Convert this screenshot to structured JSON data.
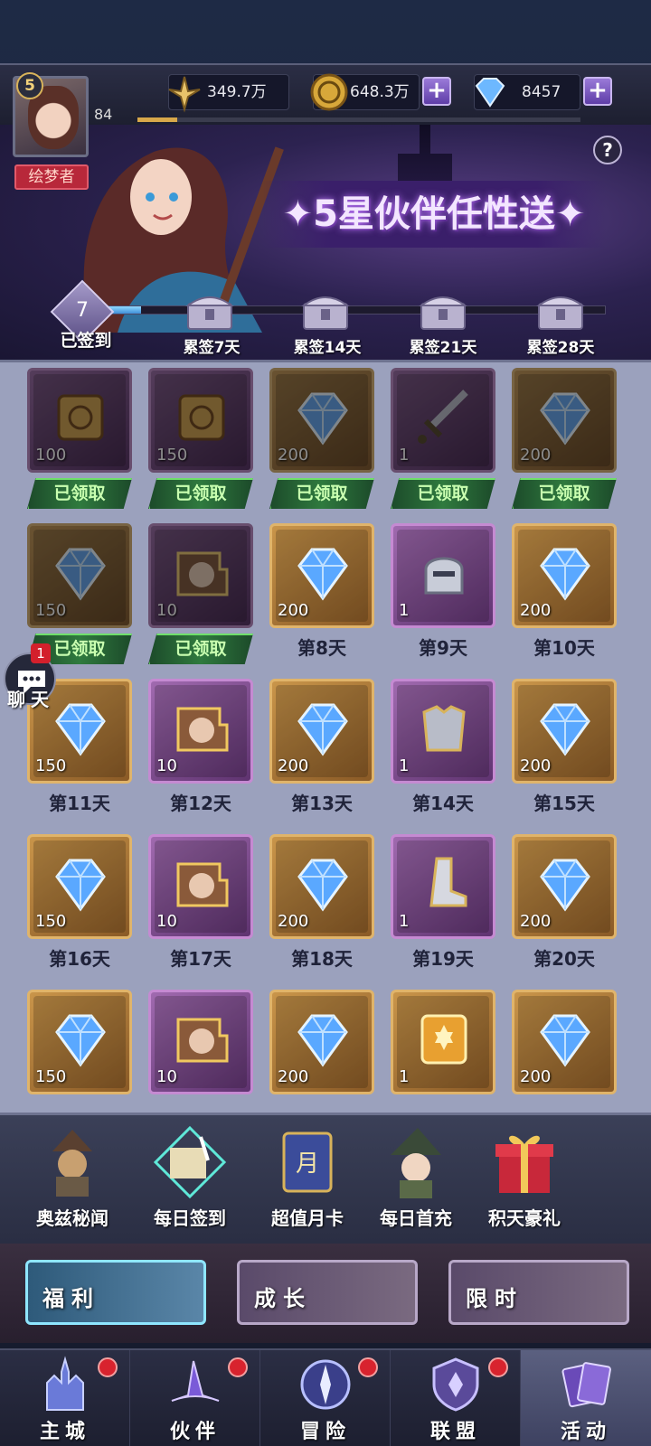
{
  "header": {
    "level": "5",
    "exp": "84",
    "nickname": "绘梦者",
    "power": "349.7万",
    "gold": "648.3万",
    "diamonds": "8457",
    "help": "?"
  },
  "banner": {
    "title": "✦5星伙伴任性送✦",
    "signed_days": "7",
    "signed_label": "已签到",
    "progress_fraction": 0.08,
    "milestones": [
      "累签7天",
      "累签14天",
      "累签21天",
      "累签28天"
    ]
  },
  "rewards": [
    {
      "item": "scroll-icon",
      "qty": "100",
      "label": "已领取",
      "claimed": true,
      "frame": "purple"
    },
    {
      "item": "scroll-icon",
      "qty": "150",
      "label": "已领取",
      "claimed": true,
      "frame": "purple"
    },
    {
      "item": "diamond-icon",
      "qty": "200",
      "label": "已领取",
      "claimed": true,
      "frame": "gold"
    },
    {
      "item": "sword-icon",
      "qty": "1",
      "label": "已领取",
      "claimed": true,
      "frame": "purple"
    },
    {
      "item": "diamond-icon",
      "qty": "200",
      "label": "已领取",
      "claimed": true,
      "frame": "gold"
    },
    {
      "item": "diamond-icon",
      "qty": "150",
      "label": "已领取",
      "claimed": true,
      "frame": "gold"
    },
    {
      "item": "hero-fragment-icon",
      "qty": "10",
      "label": "已领取",
      "claimed": true,
      "frame": "purple"
    },
    {
      "item": "diamond-icon",
      "qty": "200",
      "label": "第8天",
      "claimed": false,
      "frame": "gold"
    },
    {
      "item": "helmet-icon",
      "qty": "1",
      "label": "第9天",
      "claimed": false,
      "frame": "purple"
    },
    {
      "item": "diamond-icon",
      "qty": "200",
      "label": "第10天",
      "claimed": false,
      "frame": "gold"
    },
    {
      "item": "diamond-icon",
      "qty": "150",
      "label": "第11天",
      "claimed": false,
      "frame": "gold"
    },
    {
      "item": "hero-fragment-icon",
      "qty": "10",
      "label": "第12天",
      "claimed": false,
      "frame": "purple"
    },
    {
      "item": "diamond-icon",
      "qty": "200",
      "label": "第13天",
      "claimed": false,
      "frame": "gold"
    },
    {
      "item": "armor-icon",
      "qty": "1",
      "label": "第14天",
      "claimed": false,
      "frame": "purple"
    },
    {
      "item": "diamond-icon",
      "qty": "200",
      "label": "第15天",
      "claimed": false,
      "frame": "gold"
    },
    {
      "item": "diamond-icon",
      "qty": "150",
      "label": "第16天",
      "claimed": false,
      "frame": "gold"
    },
    {
      "item": "hero-fragment-icon",
      "qty": "10",
      "label": "第17天",
      "claimed": false,
      "frame": "purple"
    },
    {
      "item": "diamond-icon",
      "qty": "200",
      "label": "第18天",
      "claimed": false,
      "frame": "gold"
    },
    {
      "item": "boots-icon",
      "qty": "1",
      "label": "第19天",
      "claimed": false,
      "frame": "purple"
    },
    {
      "item": "diamond-icon",
      "qty": "200",
      "label": "第20天",
      "claimed": false,
      "frame": "gold"
    },
    {
      "item": "diamond-icon",
      "qty": "150",
      "label": "",
      "claimed": false,
      "frame": "gold"
    },
    {
      "item": "hero-fragment-icon",
      "qty": "10",
      "label": "",
      "claimed": false,
      "frame": "purple"
    },
    {
      "item": "diamond-icon",
      "qty": "200",
      "label": "",
      "claimed": false,
      "frame": "gold"
    },
    {
      "item": "relic-icon",
      "qty": "1",
      "label": "",
      "claimed": false,
      "frame": "gold"
    },
    {
      "item": "diamond-icon",
      "qty": "200",
      "label": "",
      "claimed": false,
      "frame": "gold"
    }
  ],
  "chat": {
    "badge": "1",
    "label": "聊天"
  },
  "activities": [
    "奥兹秘闻",
    "每日签到",
    "超值月卡",
    "每日首充",
    "积天豪礼"
  ],
  "categories": [
    "福利",
    "成长",
    "限时"
  ],
  "nav": [
    "主城",
    "伙伴",
    "冒险",
    "联盟",
    "活动"
  ]
}
